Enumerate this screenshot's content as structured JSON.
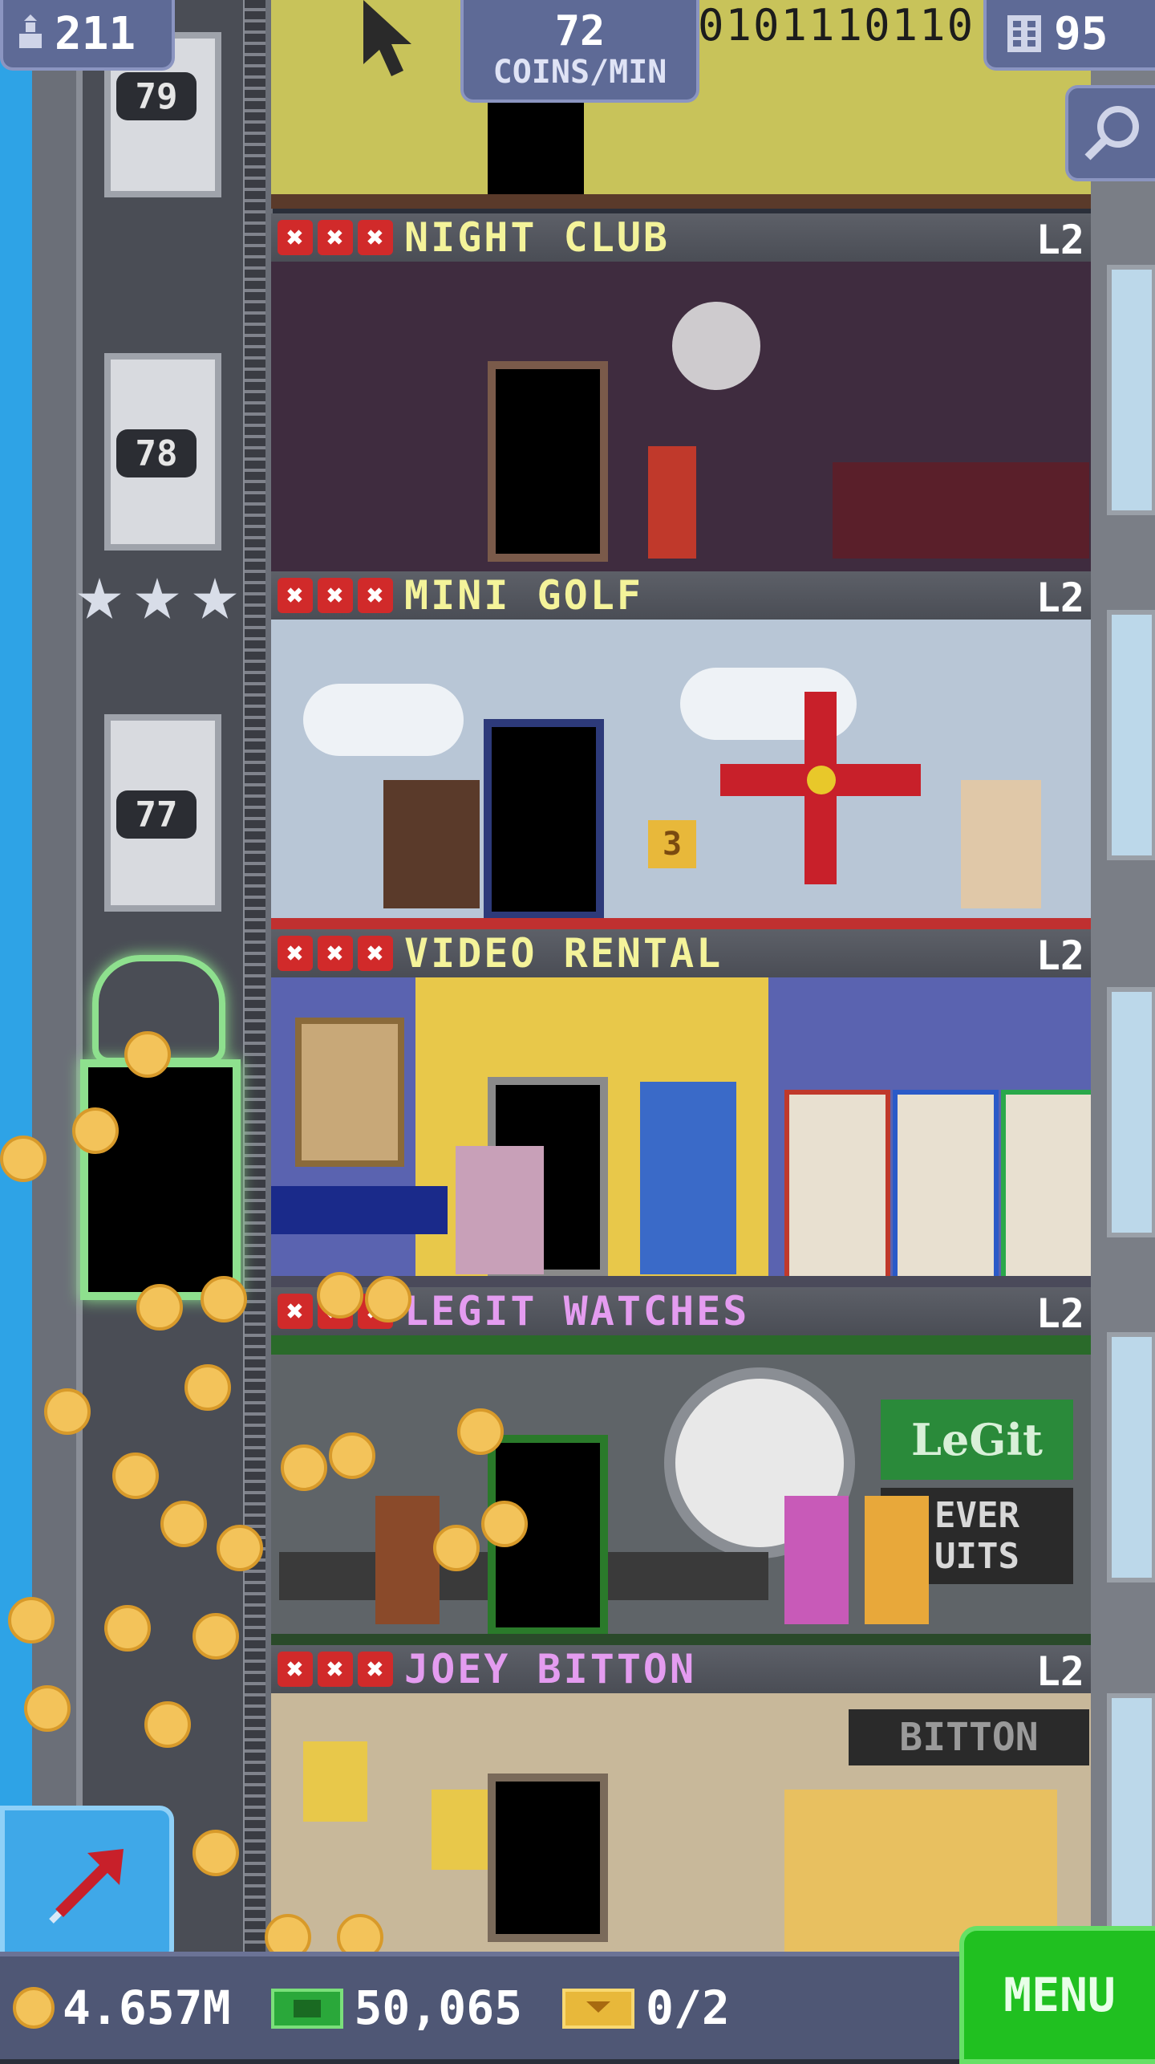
{
  "top_bar": {
    "population": "211",
    "coins_rate_value": "72",
    "coins_rate_unit": "COINS/MIN",
    "binary_code": "0101110110",
    "floors_count": "95"
  },
  "elevator": {
    "floor_numbers": [
      "79",
      "78",
      "77"
    ],
    "stars": 3
  },
  "floors": [
    {
      "name": "NIGHT CLUB",
      "level": "L2",
      "name_color": "#f4f39a",
      "x_marks": [
        "✖",
        "✖",
        "✖"
      ]
    },
    {
      "name": "MINI GOLF",
      "level": "L2",
      "name_color": "#f4f39a",
      "x_marks": [
        "✖",
        "✖",
        "✖"
      ],
      "sign": "3"
    },
    {
      "name": "VIDEO RENTAL",
      "level": "L2",
      "name_color": "#f4f39a",
      "x_marks": [
        "✖",
        "✖",
        "✖"
      ]
    },
    {
      "name": "LEGIT WATCHES",
      "level": "L2",
      "name_color": "#e49cf0",
      "x_marks": [
        "✖",
        "✖",
        "✖"
      ],
      "sign_top": "LeGit",
      "sign_bottom": "EVER\nUITS"
    },
    {
      "name": "JOEY BITTON",
      "level": "L2",
      "name_color": "#e49cf0",
      "x_marks": [
        "✖",
        "✖",
        "✖"
      ],
      "sign": "BITTON"
    }
  ],
  "bottom_bar": {
    "coins": "4.657M",
    "bux": "50,065",
    "tickets": "0/2",
    "menu_label": "MENU"
  },
  "icons": {
    "population": "person-arrow-icon",
    "floors": "building-icon",
    "search": "magnifier-icon",
    "coins": "coin-icon",
    "bux": "bux-bill-icon",
    "tickets": "ticket-icon",
    "travel": "arrow-up-right-icon"
  }
}
